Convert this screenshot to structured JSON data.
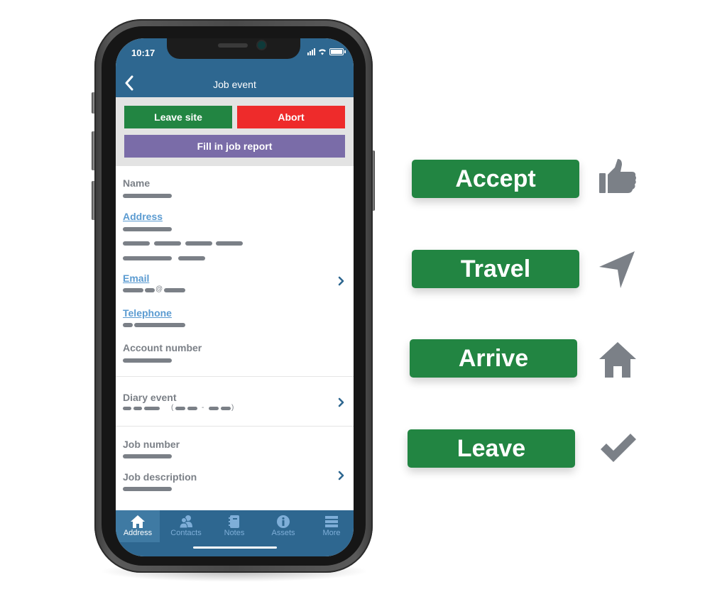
{
  "phone": {
    "status_bar": {
      "time": "10:17"
    },
    "header": {
      "title": "Job event",
      "back_icon": "chevron-left-icon"
    },
    "actions": {
      "leave_site": "Leave site",
      "abort": "Abort",
      "fill_report": "Fill in job report"
    },
    "fields": {
      "name_label": "Name",
      "address_label": "Address",
      "email_label": "Email",
      "email_at": "@",
      "telephone_label": "Telephone",
      "account_label": "Account number",
      "diary_label": "Diary event",
      "diary_open_paren": "(",
      "diary_dash": "-",
      "diary_close_paren": ")",
      "job_number_label": "Job number",
      "job_description_label": "Job description"
    },
    "tabs": [
      {
        "label": "Address",
        "icon": "home-icon",
        "active": true
      },
      {
        "label": "Contacts",
        "icon": "contacts-icon",
        "active": false
      },
      {
        "label": "Notes",
        "icon": "notebook-icon",
        "active": false
      },
      {
        "label": "Assets",
        "icon": "info-icon",
        "active": false
      },
      {
        "label": "More",
        "icon": "menu-icon",
        "active": false
      }
    ]
  },
  "status_steps": [
    {
      "label": "Accept",
      "icon": "thumbs-up-icon"
    },
    {
      "label": "Travel",
      "icon": "navigation-arrow-icon"
    },
    {
      "label": "Arrive",
      "icon": "home-icon"
    },
    {
      "label": "Leave",
      "icon": "checkmark-icon"
    }
  ],
  "colors": {
    "header_blue": "#2e6790",
    "green": "#228542",
    "red": "#ee2b2b",
    "purple": "#7a6ca8",
    "link_blue": "#5b9bd1",
    "muted_gray": "#7b8087"
  }
}
